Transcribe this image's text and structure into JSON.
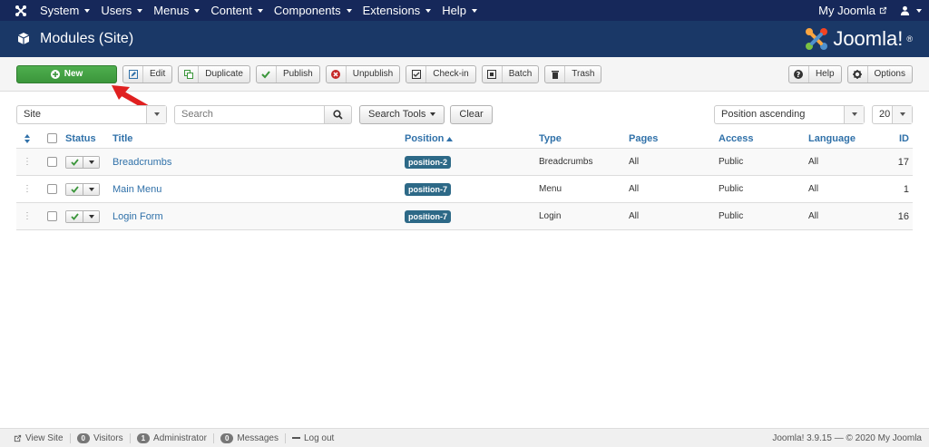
{
  "navbar": {
    "menu": [
      "System",
      "Users",
      "Menus",
      "Content",
      "Components",
      "Extensions",
      "Help"
    ],
    "site_link": "My Joomla"
  },
  "header": {
    "title": "Modules (Site)",
    "brand": "Joomla!",
    "brand_mark": "®"
  },
  "toolbar": {
    "new": "New",
    "edit": "Edit",
    "duplicate": "Duplicate",
    "publish": "Publish",
    "unpublish": "Unpublish",
    "checkin": "Check-in",
    "batch": "Batch",
    "trash": "Trash",
    "help": "Help",
    "options": "Options"
  },
  "filters": {
    "client": "Site",
    "search_placeholder": "Search",
    "search_tools": "Search Tools",
    "clear": "Clear",
    "ordering": "Position ascending",
    "limit": "20"
  },
  "table": {
    "headers": {
      "status": "Status",
      "title": "Title",
      "position": "Position",
      "type": "Type",
      "pages": "Pages",
      "access": "Access",
      "language": "Language",
      "id": "ID"
    },
    "rows": [
      {
        "title": "Breadcrumbs",
        "position": "position-2",
        "type": "Breadcrumbs",
        "pages": "All",
        "access": "Public",
        "language": "All",
        "id": "17"
      },
      {
        "title": "Main Menu",
        "position": "position-7",
        "type": "Menu",
        "pages": "All",
        "access": "Public",
        "language": "All",
        "id": "1"
      },
      {
        "title": "Login Form",
        "position": "position-7",
        "type": "Login",
        "pages": "All",
        "access": "Public",
        "language": "All",
        "id": "16"
      }
    ]
  },
  "footer": {
    "view_site": "View Site",
    "visitors_count": "0",
    "visitors": "Visitors",
    "admin_count": "1",
    "admin": "Administrator",
    "messages_count": "0",
    "messages": "Messages",
    "logout": "Log out",
    "copyright": "Joomla! 3.9.15 — © 2020 My Joomla"
  },
  "colors": {
    "navbar": "#16285a",
    "header": "#1a3867",
    "new_button": "#46a546",
    "link": "#3071a9",
    "badge": "#2d6987",
    "annotation_arrow": "#e02020"
  },
  "icons": {
    "logo": "joomla-icon",
    "header": "cube-icon",
    "user": "user-icon",
    "external": "external-link-icon"
  }
}
